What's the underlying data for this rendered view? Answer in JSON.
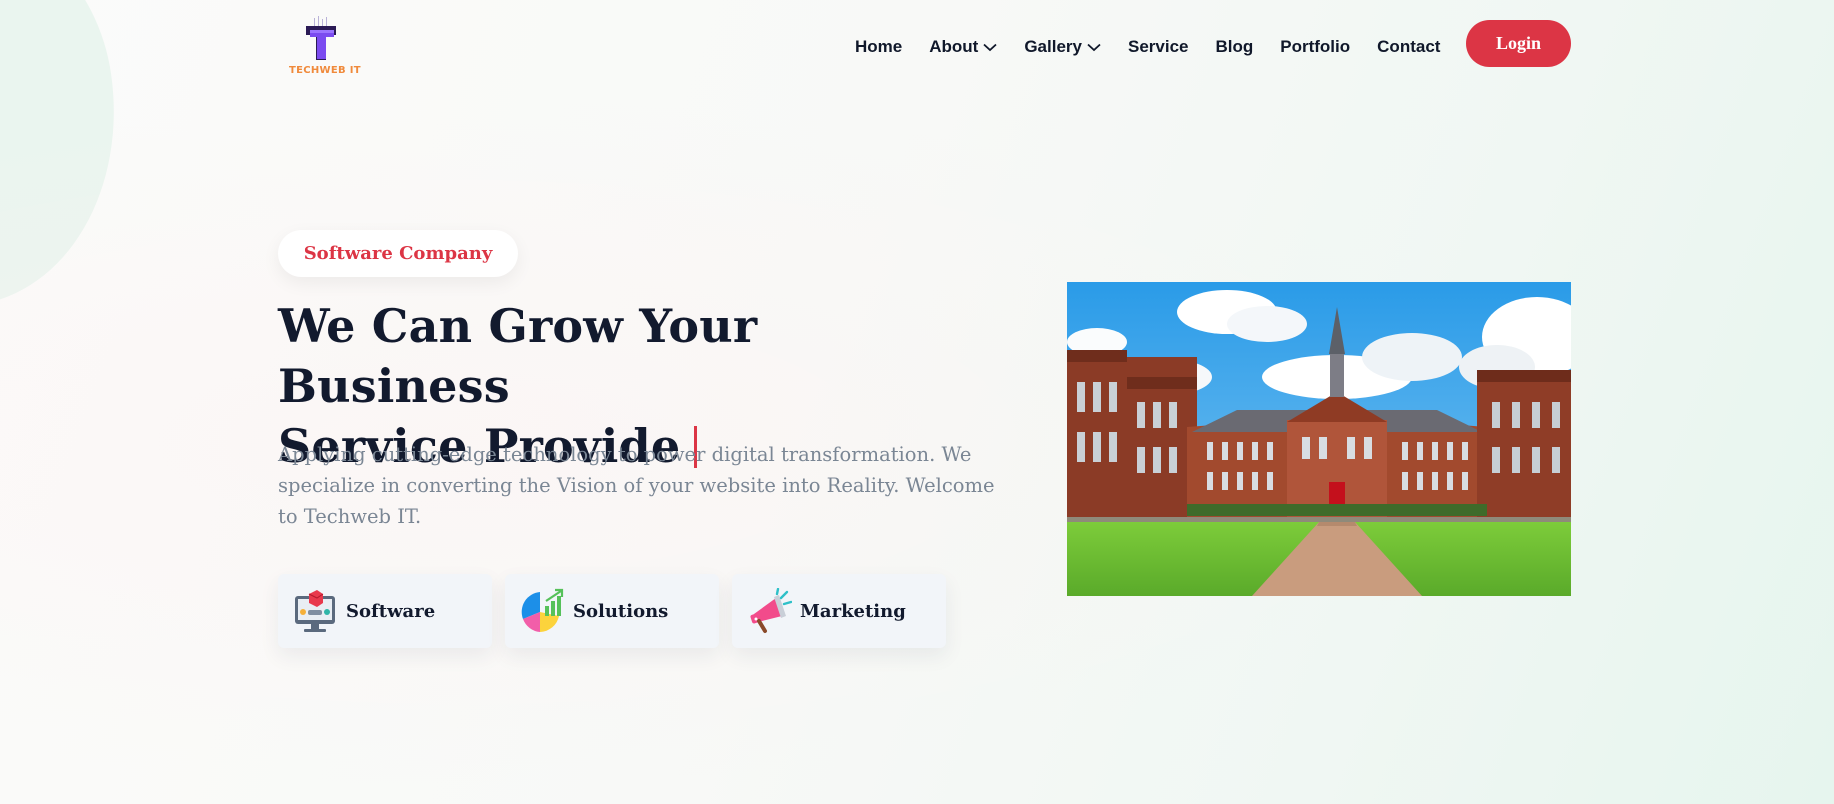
{
  "brand": {
    "logo_letter": "T",
    "logo_text": "TECHWEB IT"
  },
  "nav": {
    "items": [
      {
        "label": "Home",
        "dropdown": false
      },
      {
        "label": "About",
        "dropdown": true
      },
      {
        "label": "Gallery",
        "dropdown": true
      },
      {
        "label": "Service",
        "dropdown": false
      },
      {
        "label": "Blog",
        "dropdown": false
      },
      {
        "label": "Portfolio",
        "dropdown": false
      },
      {
        "label": "Contact",
        "dropdown": false
      }
    ],
    "login_label": "Login"
  },
  "hero": {
    "tag": "Software Company",
    "headline_line1": "We Can Grow Your Business",
    "headline_line2": "Service Provide",
    "description": "Applying cutting-edge technology to power digital transformation. We specialize in converting the Vision of your website into Reality. Welcome to Techweb IT.",
    "features": [
      {
        "label": "Software",
        "icon": "software-monitor-icon"
      },
      {
        "label": "Solutions",
        "icon": "pie-chart-growth-icon"
      },
      {
        "label": "Marketing",
        "icon": "megaphone-icon"
      }
    ],
    "image": "campus-building-photo"
  },
  "colors": {
    "accent": "#dc3545",
    "heading": "#121a2e",
    "muted": "#7a8694",
    "logo_orange": "#f08a3c",
    "logo_purple": "#6c3ce0"
  }
}
